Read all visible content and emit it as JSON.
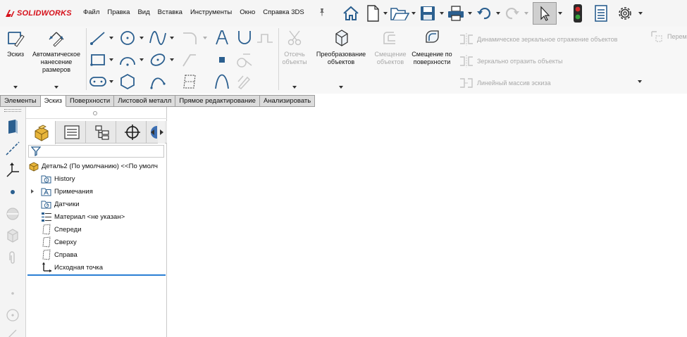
{
  "app": {
    "brand_ds": "DS",
    "brand_name": "SOLIDWORKS"
  },
  "menu": {
    "items": [
      "Файл",
      "Правка",
      "Вид",
      "Вставка",
      "Инструменты",
      "Окно",
      "Справка 3DS"
    ]
  },
  "quick_access": {
    "icons": [
      "home-icon",
      "new-document-icon",
      "open-icon",
      "save-icon",
      "print-icon",
      "undo-icon",
      "redo-icon",
      "select-arrow-icon",
      "rebuild-traffic-light-icon",
      "file-properties-icon",
      "options-gear-icon"
    ]
  },
  "ribbon": {
    "sketch": "Эскиз",
    "smart_dimension": "Автоматическое нанесение размеров",
    "trim": "Отсечь объекты",
    "convert": "Преобразование объектов",
    "offset": "Смещение объектов",
    "offset_surface": "Смещение по поверхности",
    "dynamic_mirror": "Динамическое зеркальное отражение объектов",
    "mirror": "Зеркально отразить объекты",
    "linear_pattern": "Линейный массив эскиза",
    "move": "Перем"
  },
  "tabs": [
    "Элементы",
    "Эскиз",
    "Поверхности",
    "Листовой металл",
    "Прямое редактирование",
    "Анализировать"
  ],
  "active_tab": "Эскиз",
  "feature_tree": {
    "root": "Деталь2 (По умолчанию) <<По умолч",
    "items": [
      "History",
      "Примечания",
      "Датчики",
      "Материал <не указан>",
      "Спереди",
      "Сверху",
      "Справа",
      "Исходная точка"
    ]
  },
  "colors": {
    "brand_red": "#d6101a",
    "accent_blue": "#2a7fd4",
    "part_yellow": "#e8b53a"
  }
}
